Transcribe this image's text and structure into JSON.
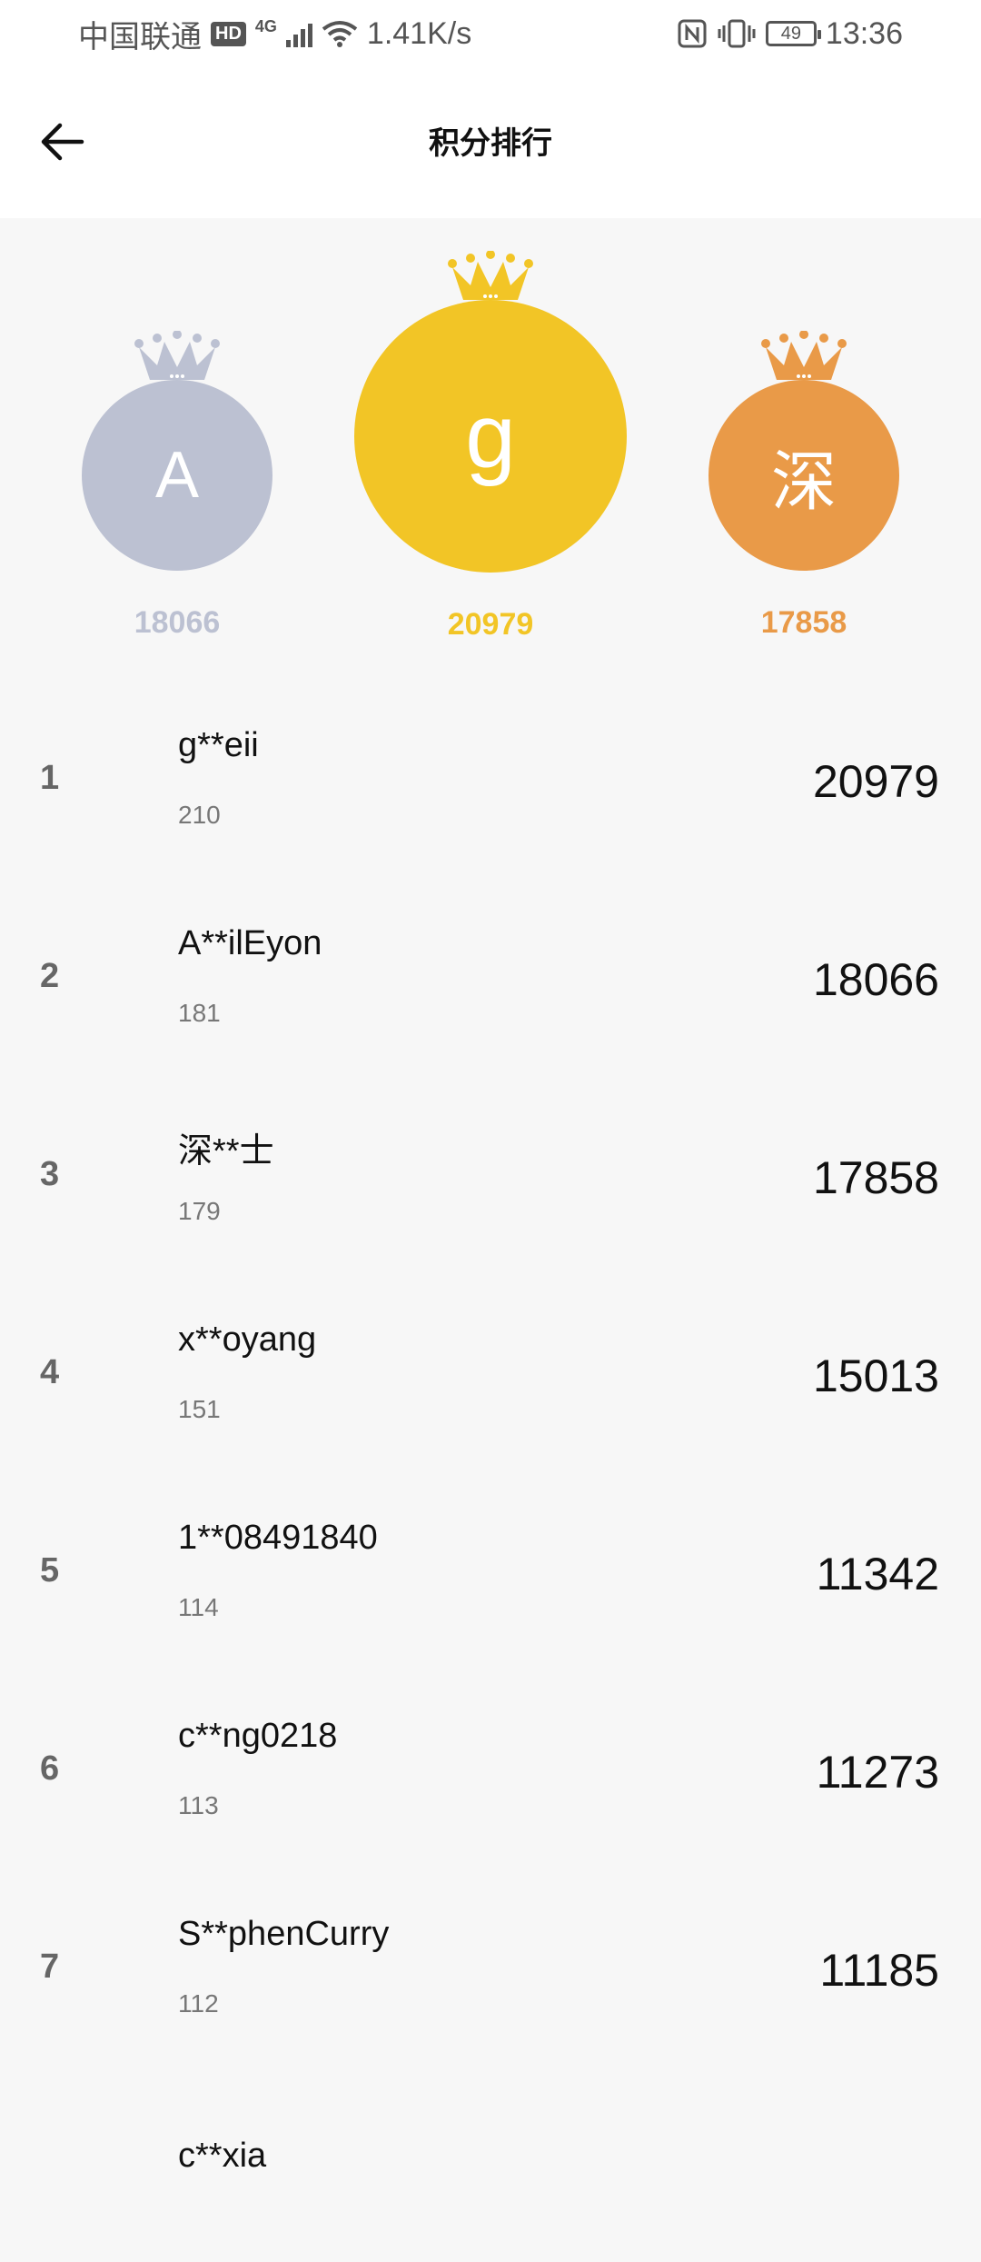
{
  "status_bar": {
    "carrier": "中国联通",
    "hd": "HD",
    "network": "4G",
    "speed": "1.41K/s",
    "battery": "49",
    "time": "13:36"
  },
  "header": {
    "title": "积分排行",
    "back_icon": "arrow-left-icon"
  },
  "podium": {
    "second": {
      "initial": "A",
      "score": "18066",
      "color": "#BCC1D2"
    },
    "first": {
      "initial": "g",
      "score": "20979",
      "color": "#F2C526"
    },
    "third": {
      "initial": "深",
      "score": "17858",
      "color": "#E99A48"
    }
  },
  "ranking": [
    {
      "rank": "1",
      "name": "g**eii",
      "sub": "210",
      "points": "20979"
    },
    {
      "rank": "2",
      "name": "A**ilEyon",
      "sub": "181",
      "points": "18066"
    },
    {
      "rank": "3",
      "name": "深**士",
      "sub": "179",
      "points": "17858"
    },
    {
      "rank": "4",
      "name": "x**oyang",
      "sub": "151",
      "points": "15013"
    },
    {
      "rank": "5",
      "name": "1**08491840",
      "sub": "114",
      "points": "11342"
    },
    {
      "rank": "6",
      "name": "c**ng0218",
      "sub": "113",
      "points": "11273"
    },
    {
      "rank": "7",
      "name": "S**phenCurry",
      "sub": "112",
      "points": "11185"
    }
  ],
  "partial_row": {
    "name": "c**xia"
  }
}
